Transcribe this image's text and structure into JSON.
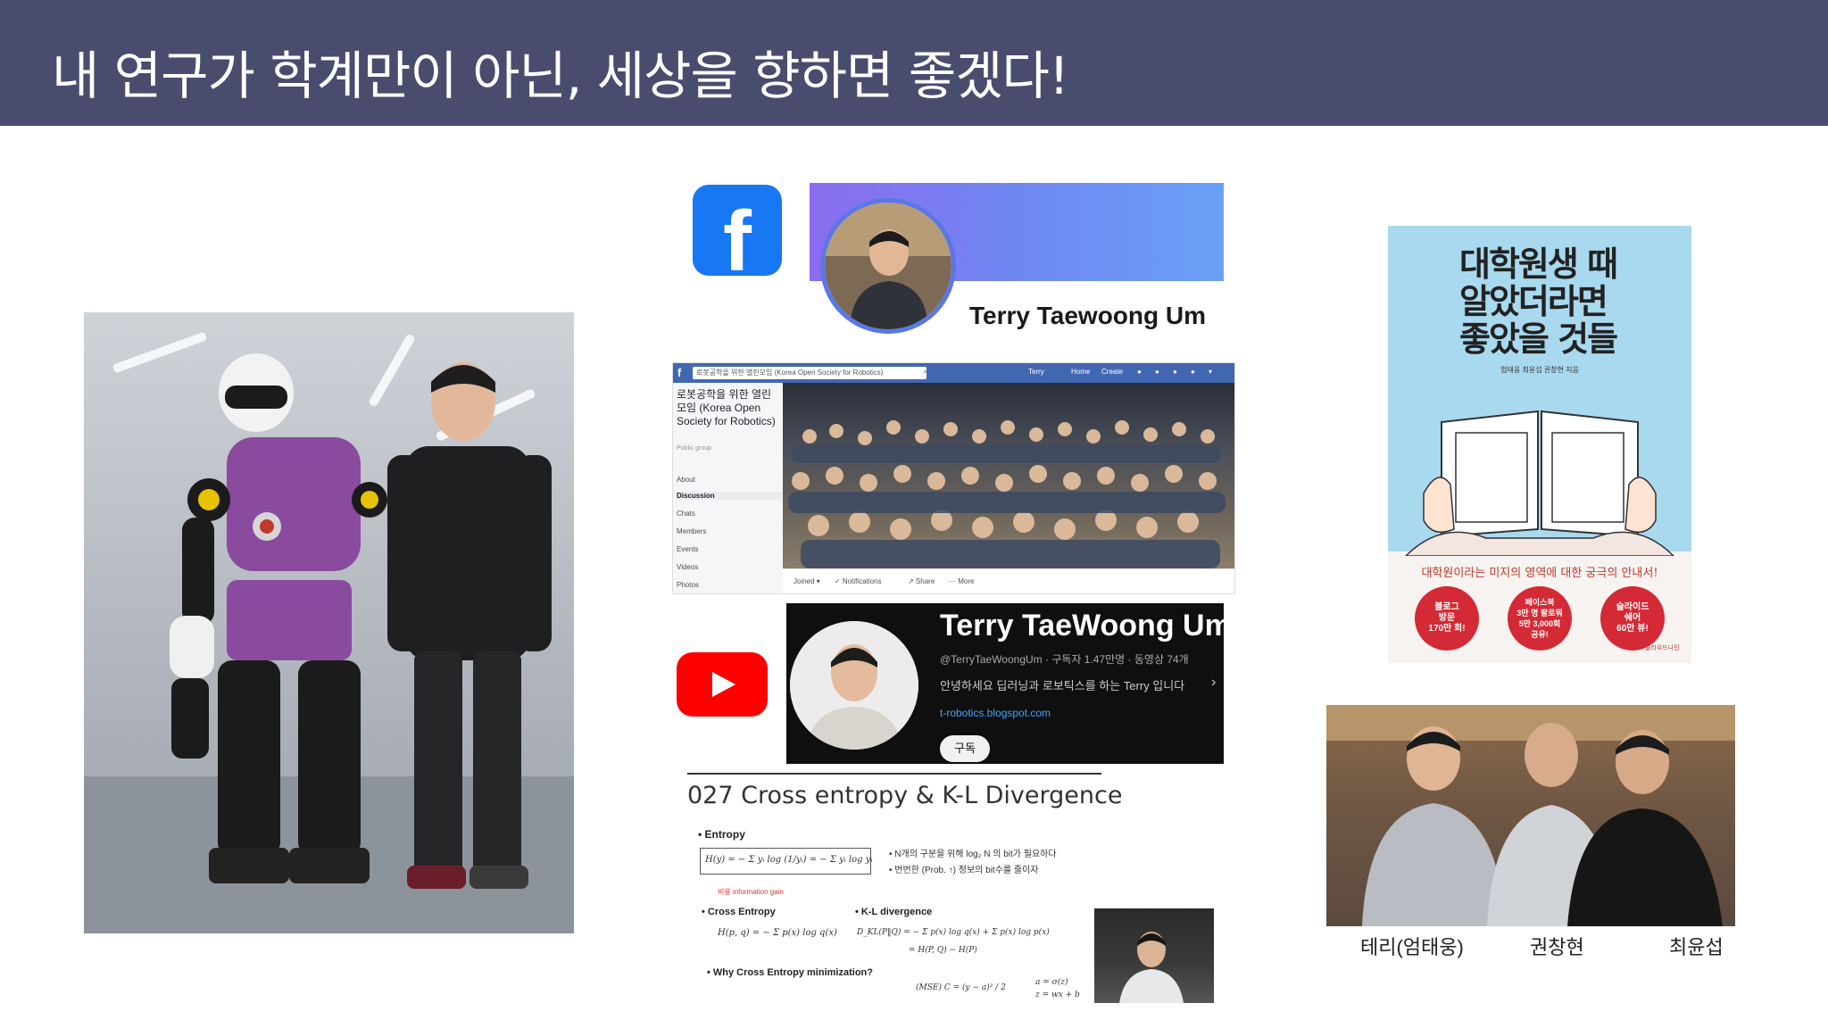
{
  "header": {
    "title": "내 연구가 학계만이 아닌, 세상을 향하면 좋겠다!"
  },
  "facebook": {
    "logo_letter": "f",
    "profile_name": "Terry Taewoong Um"
  },
  "facebook_group": {
    "search_text": "로봇공학을 위한 열린모임 (Korea Open Society for Robotics)",
    "top_nav": [
      "Terry",
      "Home",
      "Create"
    ],
    "group_name": "로봇공학을 위한 열린모임 (Korea Open Society for Robotics)",
    "privacy": "Public group",
    "nav_items": [
      "About",
      "Discussion",
      "Chats",
      "Members",
      "Events",
      "Videos",
      "Photos"
    ],
    "actions": [
      "Joined ▾",
      "✓ Notifications",
      "↗ Share",
      "··· More"
    ]
  },
  "youtube": {
    "channel_name": "Terry TaeWoong Um",
    "handle": "@TerryTaeWoongUm · 구독자 1.47만명 · 동영상 74개",
    "description": "안녕하세요 딥러닝과 로보틱스를 하는 Terry 입니다",
    "chevron": "›",
    "link": "t-robotics.blogspot.com",
    "subscribe_label": "구독"
  },
  "slide": {
    "title": "027 Cross entropy & K-L Divergence",
    "bullet_entropy": "• Entropy",
    "entropy_formula": "H(y) = − Σ yᵢ log (1/yᵢ) = − Σ yᵢ log yᵢ",
    "entropy_red": "비용      information gain",
    "note_1": "• N개의 구분을 위해 log₂ N 의 bit가 필요하다",
    "note_2": "• 번번한 (Prob. ↑) 정보의 bit수를 줄이자",
    "bullet_cross": "• Cross Entropy",
    "cross_formula": "H(p, q) = − Σ p(x) log q(x)",
    "bullet_kl": "• K-L divergence",
    "kl_formula": "D_KL(P‖Q) = − Σ p(x) log q(x) + Σ p(x) log p(x)",
    "kl_formula_2": "=        H(P, Q)        −        H(P)",
    "bullet_why": "• Why Cross Entropy minimization?",
    "mse_formula": "(MSE)  C = (y − a)² / 2",
    "sigma_formula": "a = σ(z)",
    "z_formula": "z = wx + b"
  },
  "book": {
    "title": "대학원생 때 알았더라면 좋았을 것들",
    "author": "엄태웅 최윤섭 권창현 지음",
    "subtitle": "대학원이라는 미지의 영역에 대한 궁극의 안내서!",
    "badges": [
      "블로그\n방문\n170만 회!",
      "페이스북\n3만 명 팔로워\n5만 3,000회\n공유!",
      "슬라이드\n쉐어\n60만 뷰!"
    ],
    "publisher": "클라우드나인"
  },
  "captions": [
    "테리(엄태웅)",
    "권창현",
    "최윤섭"
  ],
  "colors": {
    "header_bg": "#4a4c6e",
    "facebook_blue": "#1877f2",
    "youtube_red": "#ff0000",
    "book_sky": "#a8d9ee",
    "badge_red": "#d42a36"
  }
}
